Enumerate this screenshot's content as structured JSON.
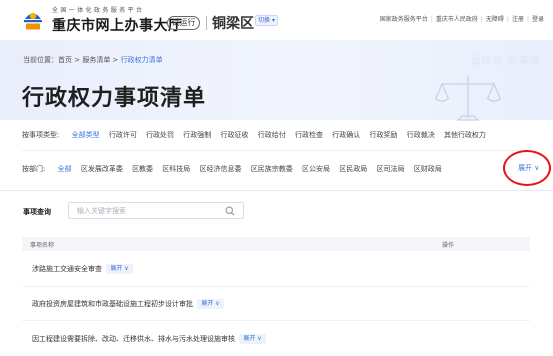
{
  "header": {
    "logo_subtitle": "全国一体化政务服务平台",
    "logo_title": "重庆市网上办事大厅",
    "trial_badge": "试运行",
    "district": "铜梁区",
    "switch_label": "切换",
    "top_links": [
      "国家政务服务平台",
      "重庆市人民政府",
      "无障碍",
      "注册",
      "登录"
    ]
  },
  "banner": {
    "breadcrumb": {
      "prefix": "当前位置：",
      "items": [
        "首页",
        "服务清单"
      ],
      "current": "行政权力清单",
      "separator": " > "
    },
    "title": "行政权力事项清单",
    "motto": "最快办 办事快"
  },
  "filters": {
    "type_label": "按事项类型:",
    "types": [
      "全部类型",
      "行政许可",
      "行政处罚",
      "行政强制",
      "行政征收",
      "行政给付",
      "行政检查",
      "行政确认",
      "行政奖励",
      "行政裁决",
      "其他行政权力"
    ],
    "type_selected": 0,
    "dept_label": "按部门:",
    "depts": [
      "全部",
      "区发展改革委",
      "区教委",
      "区科技局",
      "区经济信息委",
      "区民族宗教委",
      "区公安局",
      "区民政局",
      "区司法局",
      "区财政局"
    ],
    "dept_selected": 0,
    "expand_label": "展开"
  },
  "search": {
    "label": "事项查询",
    "placeholder": "输入关键字搜索"
  },
  "table": {
    "col_name": "事项名称",
    "col_op": "操作",
    "unfold_label": "展开",
    "rows": [
      "涉路施工交通安全审查",
      "政府投资房屋建筑和市政基础设施工程初步设计审批",
      "因工程建设需要拆除、改动、迁移供水、排水与污水处理设施审核"
    ]
  },
  "colors": {
    "accent": "#3f73d9",
    "highlight_circle": "#e3151a",
    "banner_bg": "#eef2fc"
  }
}
